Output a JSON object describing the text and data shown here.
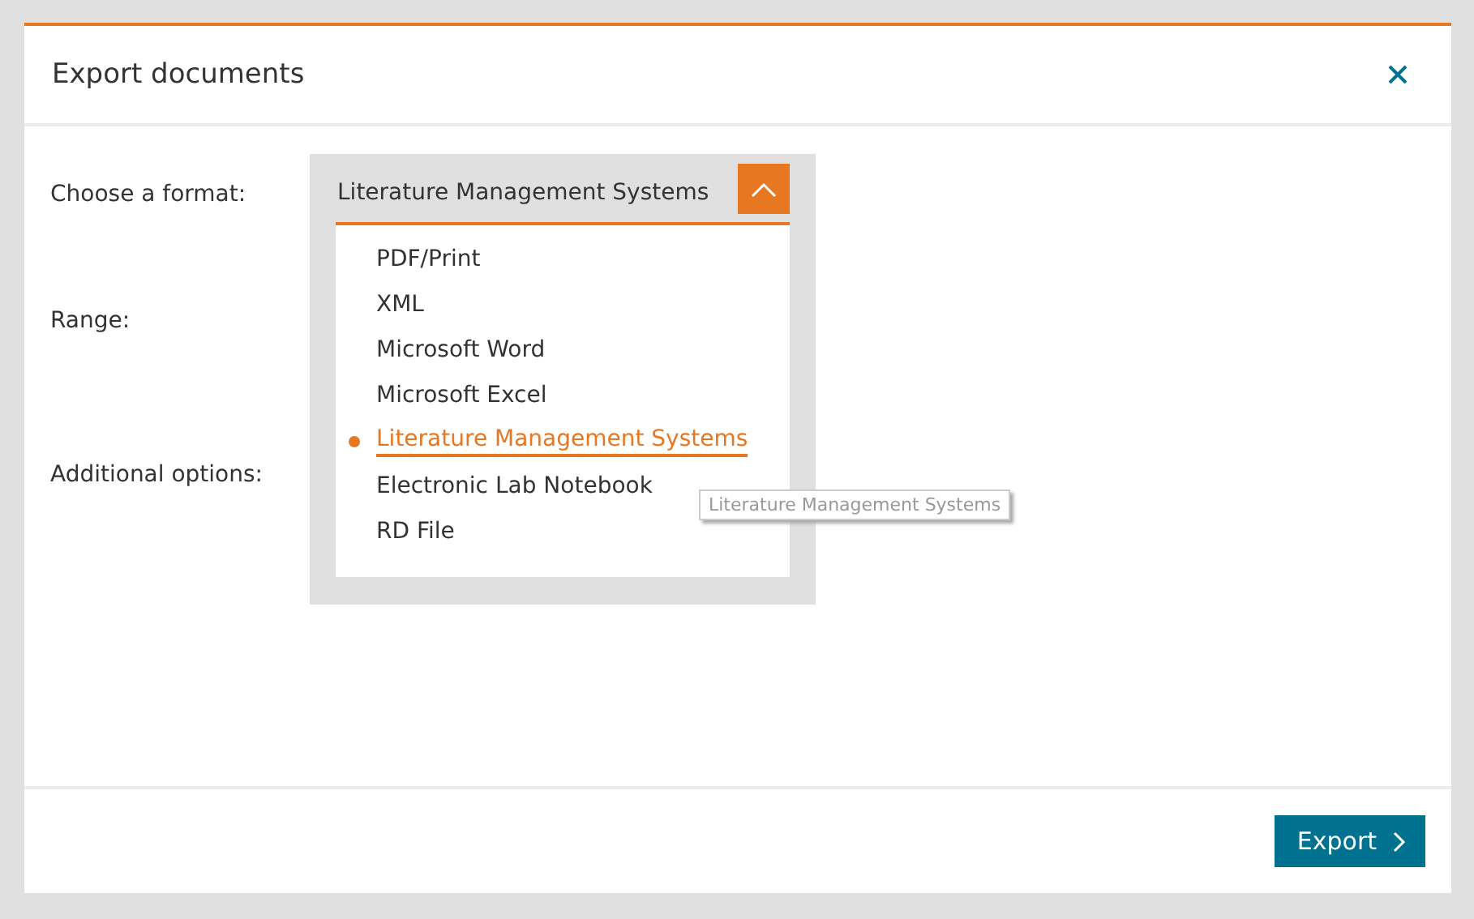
{
  "dialog": {
    "title": "Export documents"
  },
  "fields": [
    {
      "label": "Choose a format:"
    },
    {
      "label": "Range:"
    },
    {
      "label": "Additional options:"
    }
  ],
  "format_dropdown": {
    "value": "Literature Management Systems",
    "expanded": true,
    "options": [
      {
        "label": "PDF/Print",
        "selected": false
      },
      {
        "label": "XML",
        "selected": false
      },
      {
        "label": "Microsoft Word",
        "selected": false
      },
      {
        "label": "Microsoft Excel",
        "selected": false
      },
      {
        "label": "Literature Management Systems",
        "selected": true
      },
      {
        "label": "Electronic Lab Notebook",
        "selected": false
      },
      {
        "label": "RD File",
        "selected": false
      }
    ]
  },
  "tooltip": "Literature Management Systems",
  "buttons": [
    {
      "label": "Export"
    }
  ]
}
